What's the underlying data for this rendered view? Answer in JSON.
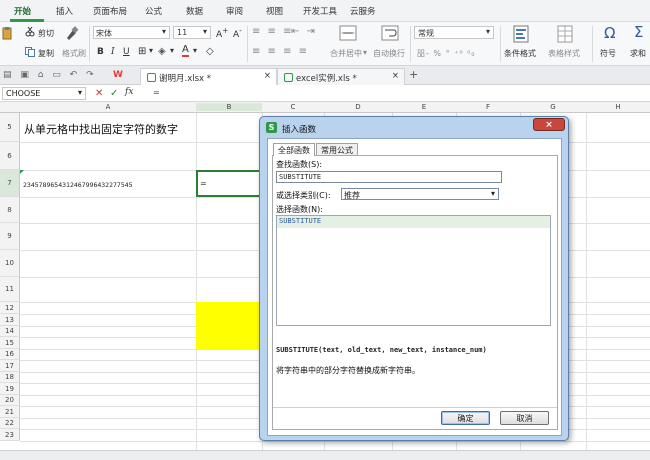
{
  "menu": {
    "tabs": [
      "开始",
      "插入",
      "页面布局",
      "公式",
      "数据",
      "审阅",
      "视图",
      "开发工具",
      "云服务"
    ]
  },
  "ribbon": {
    "cut": "剪切",
    "copy": "复制",
    "format_painter": "格式刷",
    "font_name": "宋体",
    "font_size": "11",
    "merge_center": "合并居中",
    "wrap_text": "自动换行",
    "number_format": "常规",
    "conditional_format": "条件格式",
    "table_style": "表格样式",
    "symbol": "符号",
    "sum": "求和"
  },
  "doc_tabs": [
    {
      "label": "谢明月.xlsx *"
    },
    {
      "label": "excel实例.xls *"
    }
  ],
  "formula_bar": {
    "name_box": "CHOOSE",
    "formula": "="
  },
  "grid": {
    "columns": [
      "A",
      "B",
      "C",
      "D",
      "E",
      "F",
      "G",
      "H"
    ],
    "rows": [
      "5",
      "6",
      "7",
      "8",
      "9",
      "10",
      "11",
      "12",
      "13",
      "14",
      "15",
      "16",
      "17",
      "18",
      "19",
      "20",
      "21",
      "22",
      "23"
    ],
    "a5": "从单元格中找出固定字符的数字",
    "a7": "2345789654312467996432277545",
    "b7": "="
  },
  "dialog": {
    "title": "插入函数",
    "close": "×",
    "tabs": [
      "全部函数",
      "常用公式"
    ],
    "search_label": "查找函数(S):",
    "search_value": "SUBSTITUTE",
    "category_label": "或选择类别(C):",
    "category_value": "推荐",
    "select_label": "选择函数(N):",
    "functions": [
      "SUBSTITUTE"
    ],
    "signature": "SUBSTITUTE(text, old_text, new_text, instance_num)",
    "description": "将字符串中的部分字符替换成新字符串。",
    "ok": "确定",
    "cancel": "取消"
  },
  "colors": {
    "accent": "#2e9a46",
    "highlight": "#ffff00",
    "selection": "#e3f0e3"
  }
}
